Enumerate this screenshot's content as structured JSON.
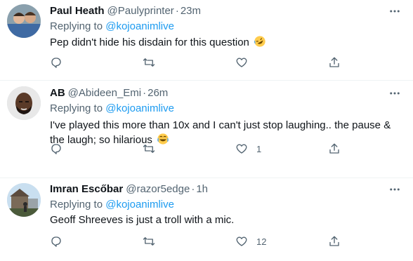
{
  "tweets": [
    {
      "name": "Paul Heath",
      "handle": "@Paulyprinter",
      "separator": "·",
      "time": "23m",
      "replying_prefix": "Replying to",
      "replying_to": "@kojoanimlive",
      "text": "Pep didn't hide his disdain for this question",
      "emoji": "rofl-emoji",
      "likes": ""
    },
    {
      "name": "AB",
      "handle": "@Abideen_Emi",
      "separator": "·",
      "time": "26m",
      "replying_prefix": "Replying to",
      "replying_to": "@kojoanimlive",
      "text": "I've played this more than 10x and I can't just stop laughing.. the pause & the laugh; so hilarious",
      "emoji": "joy-emoji",
      "likes": "1"
    },
    {
      "name": "Imran Escőbar",
      "handle": "@razor5edge",
      "separator": "·",
      "time": "1h",
      "replying_prefix": "Replying to",
      "replying_to": "@kojoanimlive",
      "text": "Geoff Shreeves is just a troll with a mic.",
      "emoji": "",
      "likes": "12"
    }
  ],
  "colors": {
    "text_primary": "#0f1419",
    "text_secondary": "#536471",
    "link": "#1d9bf0",
    "divider": "#eff3f4"
  },
  "icons": [
    "reply-icon",
    "retweet-icon",
    "like-icon",
    "share-icon",
    "more-icon"
  ]
}
